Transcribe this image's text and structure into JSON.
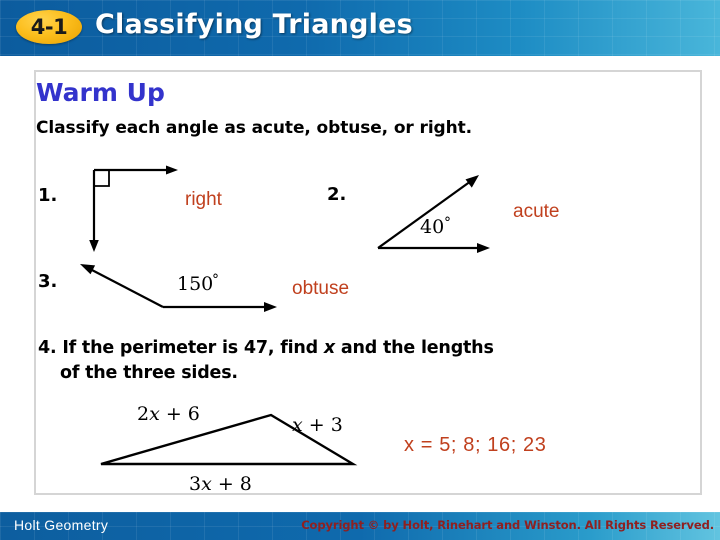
{
  "header": {
    "lesson_number": "4-1",
    "title": "Classifying Triangles",
    "badge_color": "#fcbe1d",
    "bar_color": "#0f6aad"
  },
  "panel": {
    "warmup_title": "Warm Up",
    "instruction": "Classify each angle as acute, obtuse, or right.",
    "answer_color": "#c0401e",
    "title_color": "#3333cc"
  },
  "problems": [
    {
      "number": "1.",
      "figure": "right-angle-figure",
      "angle_label": "",
      "answer": "right"
    },
    {
      "number": "2.",
      "figure": "acute-angle-figure",
      "angle_label": "40°",
      "answer": "acute"
    },
    {
      "number": "3.",
      "figure": "obtuse-angle-figure",
      "angle_label": "150°",
      "answer": "obtuse"
    }
  ],
  "problem4": {
    "line1_before": "4. If the perimeter is 47, find ",
    "variable": "x",
    "line1_after": " and the lengths",
    "line2": "of the three sides.",
    "triangle": {
      "side_top_left": "2x + 6",
      "side_top_right": "x + 3",
      "side_bottom": "3x + 8"
    },
    "answer": "x = 5; 8; 16; 23"
  },
  "footer": {
    "brand": "Holt Geometry",
    "copyright": "Copyright © by Holt, Rinehart and Winston. All Rights Reserved.",
    "copyright_color": "#8f2020"
  }
}
